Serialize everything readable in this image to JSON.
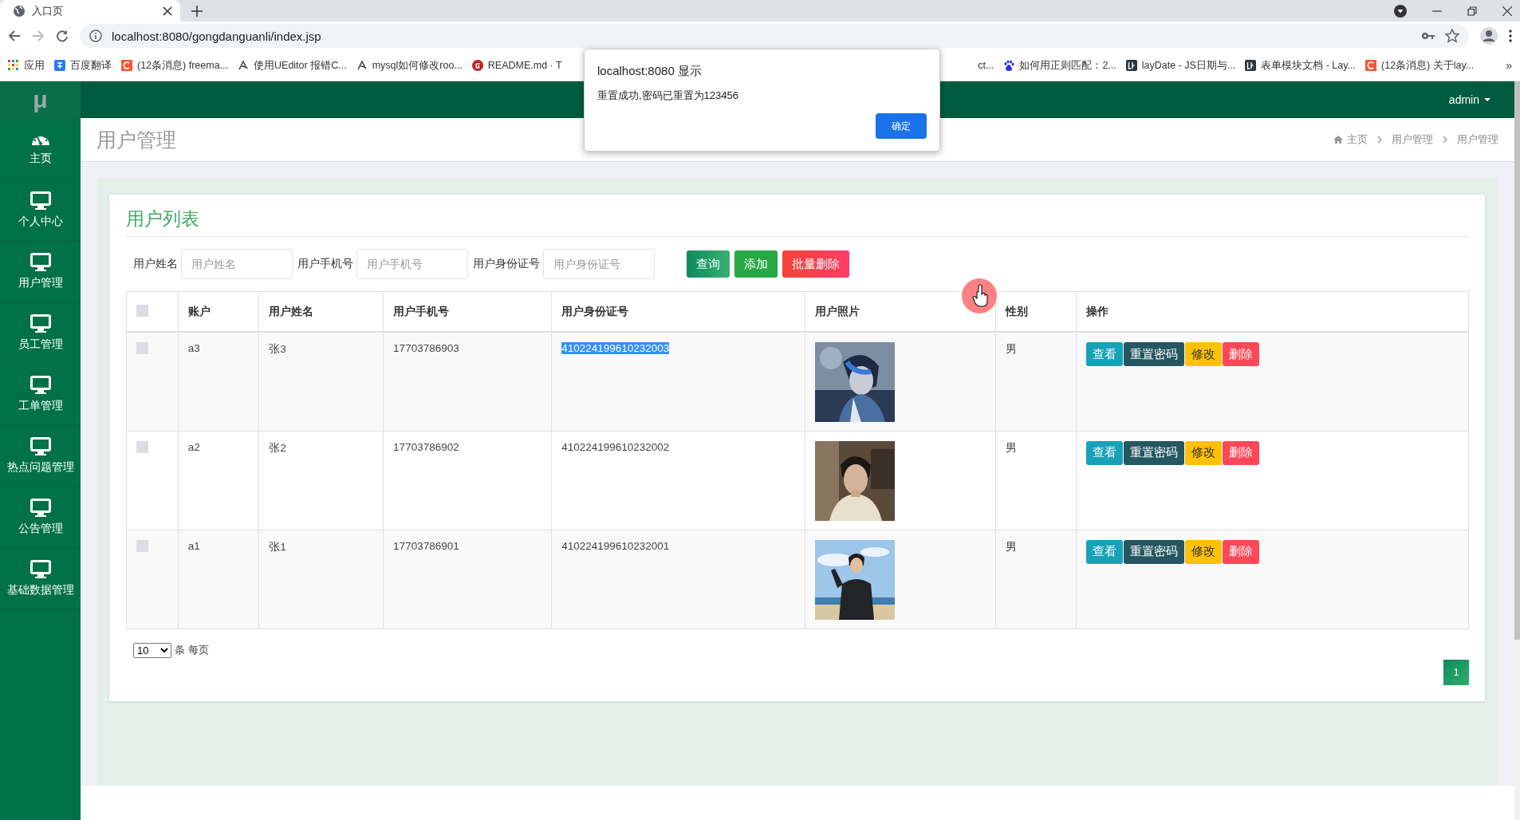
{
  "browser": {
    "tab": {
      "title": "入口页",
      "selected": true
    },
    "url": "localhost:8080/gongdanguanli/index.jsp",
    "bookmarks_left": [
      {
        "label": "应用"
      },
      {
        "label": "百度翻译"
      },
      {
        "label": "(12条消息) freema..."
      },
      {
        "label": "使用UEditor 报错C..."
      },
      {
        "label": "mysql如何修改roo..."
      },
      {
        "label": "README.md · T"
      }
    ],
    "bookmarks_right": [
      {
        "label": "ct..."
      },
      {
        "label": "如何用正则匹配：2..."
      },
      {
        "label": "layDate - JS日期与..."
      },
      {
        "label": "表单模块文档 - Lay..."
      },
      {
        "label": "(12条消息) 关于lay..."
      }
    ],
    "more": "»"
  },
  "app": {
    "logo": "μ",
    "user": "admin",
    "sidebar": [
      {
        "label": "主页"
      },
      {
        "label": "个人中心"
      },
      {
        "label": "用户管理"
      },
      {
        "label": "员工管理"
      },
      {
        "label": "工单管理"
      },
      {
        "label": "热点问题管理"
      },
      {
        "label": "公告管理"
      },
      {
        "label": "基础数据管理"
      }
    ],
    "page_title": "用户管理",
    "breadcrumb": [
      "主页",
      "用户管理",
      "用户管理"
    ],
    "card_title": "用户列表",
    "filters": [
      {
        "label": "用户姓名",
        "placeholder": "用户姓名"
      },
      {
        "label": "用户手机号",
        "placeholder": "用户手机号"
      },
      {
        "label": "用户身份证号",
        "placeholder": "用户身份证号"
      }
    ],
    "buttons": [
      {
        "label": "查询",
        "kind": "query"
      },
      {
        "label": "添加",
        "kind": "add"
      },
      {
        "label": "批量删除",
        "kind": "delete"
      }
    ],
    "table": {
      "select_all": {
        "checked": false
      },
      "columns": [
        "账户",
        "用户姓名",
        "用户手机号",
        "用户身份证号",
        "用户照片",
        "性别",
        "操作"
      ],
      "rows": [
        {
          "checked": false,
          "account": "a3",
          "name": "张3",
          "phone": "17703786903",
          "id_number": "410224199610232003",
          "id_highlighted": true,
          "photo": {
            "kind": "picture"
          },
          "gender": "男",
          "actions": [
            {
              "label": "查看",
              "kind": "view"
            },
            {
              "label": "重置密码",
              "kind": "reset"
            },
            {
              "label": "修改",
              "kind": "edit"
            },
            {
              "label": "删除",
              "kind": "delete"
            }
          ]
        },
        {
          "checked": false,
          "account": "a2",
          "name": "张2",
          "phone": "17703786902",
          "id_number": "410224199610232002",
          "id_highlighted": false,
          "photo": {
            "kind": "picture"
          },
          "gender": "男",
          "actions": [
            {
              "label": "查看",
              "kind": "view"
            },
            {
              "label": "重置密码",
              "kind": "reset"
            },
            {
              "label": "修改",
              "kind": "edit"
            },
            {
              "label": "删除",
              "kind": "delete"
            }
          ]
        },
        {
          "checked": false,
          "account": "a1",
          "name": "张1",
          "phone": "17703786901",
          "id_number": "410224199610232001",
          "id_highlighted": false,
          "photo": {
            "kind": "picture"
          },
          "gender": "男",
          "actions": [
            {
              "label": "查看",
              "kind": "view"
            },
            {
              "label": "重置密码",
              "kind": "reset"
            },
            {
              "label": "修改",
              "kind": "edit"
            },
            {
              "label": "删除",
              "kind": "delete"
            }
          ]
        }
      ]
    },
    "pagination": {
      "page_size": "10",
      "page_size_label": "条 每页",
      "pages": [
        {
          "label": "1",
          "selected": true
        }
      ]
    }
  },
  "dialog": {
    "title": "localhost:8080 显示",
    "message": "重置成功,密码已重置为123456",
    "button": "确定"
  }
}
